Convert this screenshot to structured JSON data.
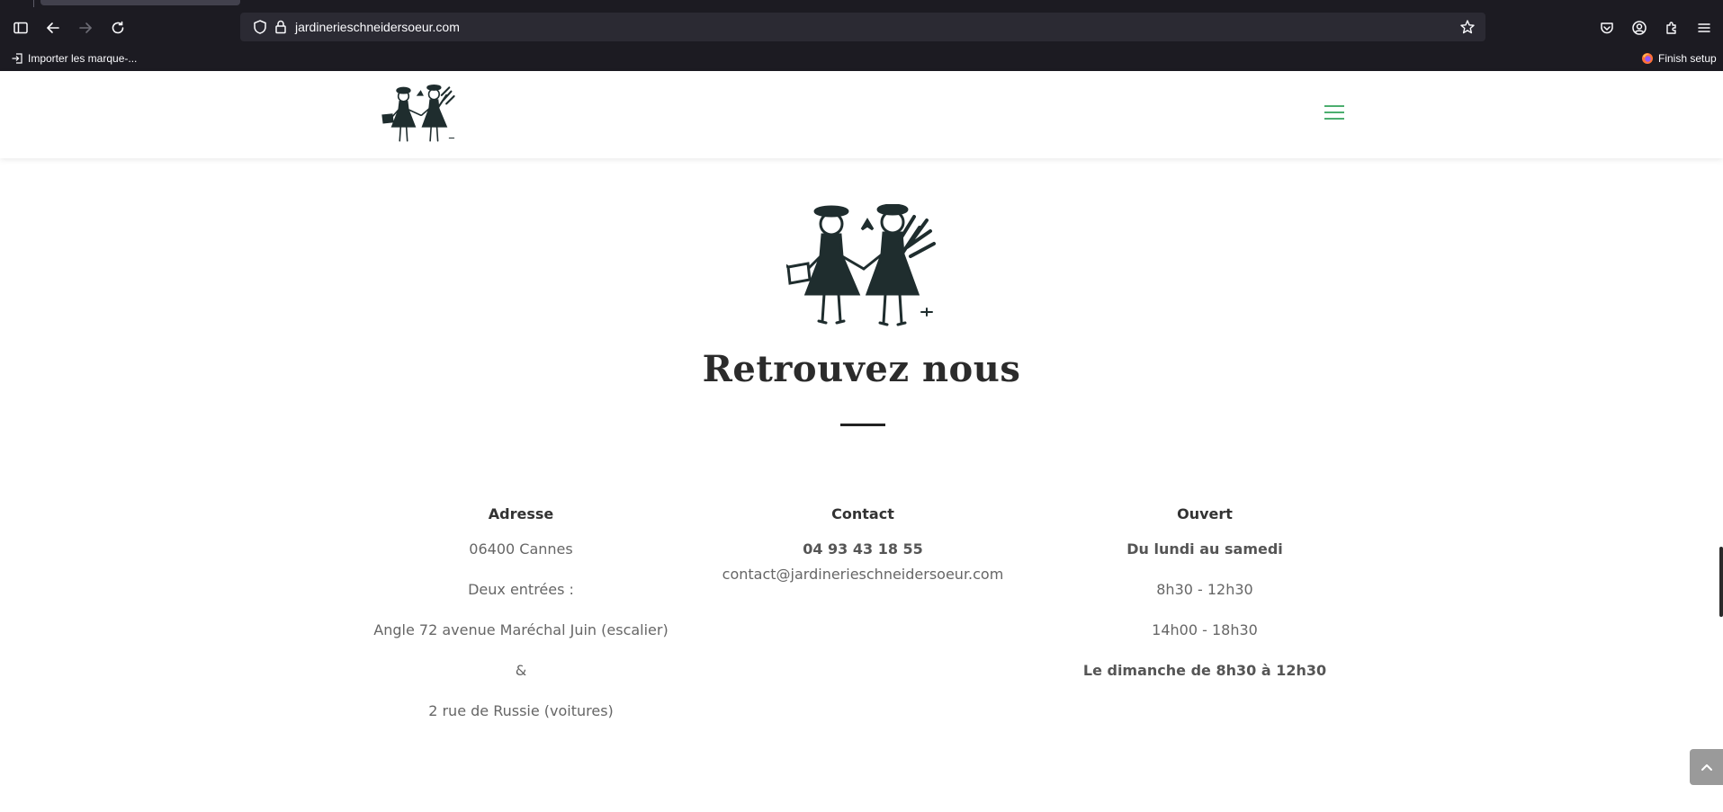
{
  "browser": {
    "url": "jardinerieschneidersoeur.com",
    "bookmark_import_label": "Importer les marque-...",
    "finish_setup_label": "Finish setup"
  },
  "site": {
    "headline": "Retrouvez nous",
    "accent_color": "#4cae6f",
    "columns": {
      "address": {
        "title": "Adresse",
        "lines": [
          "06400 Cannes",
          "Deux entrées :",
          "Angle 72 avenue Maréchal Juin (escalier)",
          "&",
          "2 rue de Russie (voitures)"
        ]
      },
      "contact": {
        "title": "Contact",
        "phone": "04 93 43 18 55",
        "email": "contact@jardinerieschneidersoeur.com"
      },
      "hours": {
        "title": "Ouvert",
        "days": "Du lundi au samedi",
        "morning": "8h30 - 12h30",
        "afternoon": "14h00 - 18h30",
        "sunday": "Le dimanche de 8h30 à 12h30"
      }
    }
  },
  "icons": {
    "sidebar": "sidebar-icon",
    "back": "back-arrow-icon",
    "forward": "forward-arrow-icon",
    "reload": "reload-icon",
    "shield": "shield-icon",
    "lock": "lock-icon",
    "bookmark_star": "star-icon",
    "pocket": "pocket-icon",
    "account": "account-icon",
    "extensions": "extensions-icon",
    "menu": "menu-icon",
    "scroll_top": "chevron-up-icon"
  }
}
